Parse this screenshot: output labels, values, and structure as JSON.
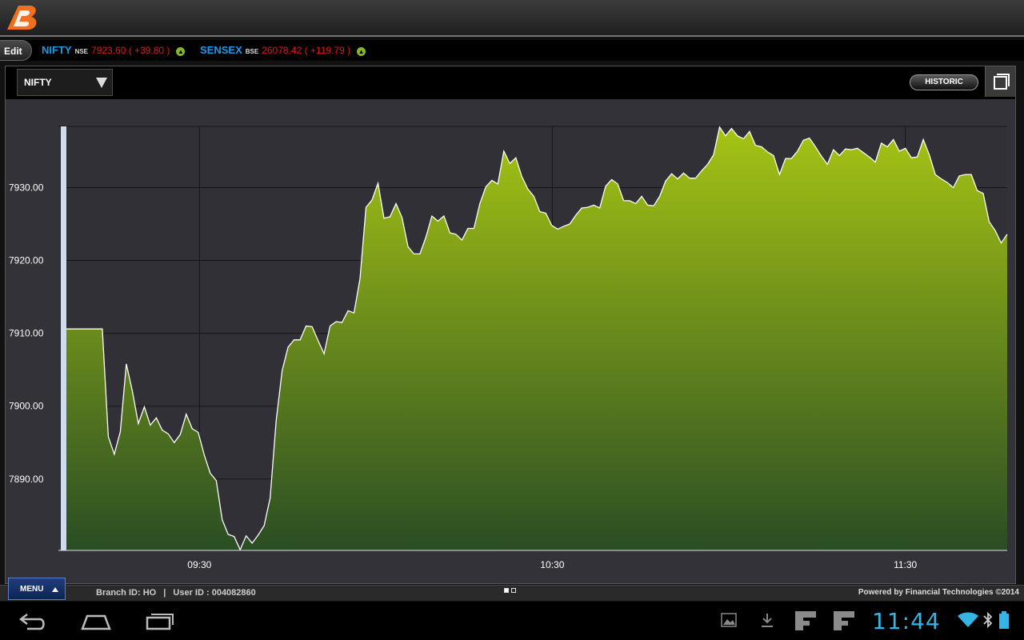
{
  "app": {
    "logo_icon": "bank-of-baroda-logo-icon",
    "accent": "#f07020"
  },
  "ticker": {
    "edit_label": "Edit",
    "items": [
      {
        "name": "NIFTY",
        "exchange": "NSE",
        "value": "7923.60 ( +39.80 )",
        "trend_icon": "up-arrow-icon"
      },
      {
        "name": "SENSEX",
        "exchange": "BSE",
        "value": "26078.42 ( +119.79 )",
        "trend_icon": "up-arrow-icon"
      }
    ]
  },
  "toolbar": {
    "index_selected": "NIFTY",
    "historic_label": "HISTORIC"
  },
  "chart_data": {
    "type": "area",
    "series": [
      {
        "values": [
          7910.6,
          7910.6,
          7910.6,
          7910.6,
          7910.6,
          7910.6,
          7910.6,
          7895.8,
          7893.4,
          7896.5,
          7905.8,
          7902.1,
          7897.6,
          7899.9,
          7897.4,
          7898.4,
          7896.7,
          7896.2,
          7895.0,
          7896.1,
          7898.9,
          7896.9,
          7896.4,
          7893.3,
          7890.8,
          7889.8,
          7884.4,
          7882.4,
          7882.1,
          7880.3,
          7882.2,
          7881.2,
          7882.3,
          7883.6,
          7887.4,
          7898.0,
          7904.9,
          7908.1,
          7909.1,
          7909.1,
          7911.0,
          7910.9,
          7909.0,
          7907.2,
          7911.0,
          7911.6,
          7911.5,
          7913.1,
          7912.8,
          7917.5,
          7927.3,
          7928.3,
          7930.6,
          7925.8,
          7926.0,
          7927.8,
          7925.9,
          7921.9,
          7920.9,
          7920.9,
          7923.2,
          7926.1,
          7925.4,
          7926.1,
          7923.8,
          7923.6,
          7922.8,
          7924.4,
          7924.4,
          7927.8,
          7930.1,
          7931.0,
          7930.5,
          7935.0,
          7933.3,
          7934.1,
          7931.5,
          7929.8,
          7928.8,
          7926.7,
          7926.5,
          7924.8,
          7924.3,
          7924.7,
          7925.0,
          7926.2,
          7927.2,
          7927.3,
          7927.6,
          7927.2,
          7930.2,
          7931.1,
          7930.5,
          7928.2,
          7928.2,
          7927.8,
          7928.8,
          7927.6,
          7927.5,
          7928.8,
          7930.9,
          7931.9,
          7931.2,
          7932.0,
          7931.3,
          7931.3,
          7932.3,
          7933.2,
          7934.5,
          7938.3,
          7937.1,
          7938.1,
          7937.1,
          7936.7,
          7937.7,
          7935.8,
          7935.6,
          7934.9,
          7934.4,
          7931.8,
          7934.0,
          7934.0,
          7935.0,
          7936.5,
          7936.8,
          7935.6,
          7934.3,
          7933.2,
          7935.2,
          7934.4,
          7935.3,
          7935.2,
          7935.4,
          7934.8,
          7934.2,
          7933.5,
          7936.1,
          7935.6,
          7936.6,
          7935.0,
          7935.4,
          7934.1,
          7934.2,
          7936.6,
          7934.5,
          7931.8,
          7931.2,
          7930.7,
          7930.0,
          7931.6,
          7931.8,
          7931.8,
          7929.6,
          7929.2,
          7925.3,
          7924.1,
          7922.4,
          7923.6
        ]
      }
    ],
    "x_tick_labels": [
      "09:30",
      "10:30",
      "11:30"
    ],
    "x_tick_fractions": [
      0.1414,
      0.5165,
      0.8917
    ],
    "y_ticks": [
      7930,
      7920,
      7910,
      7900,
      7890
    ],
    "y_tick_labels": [
      "7930.00",
      "7920.00",
      "7910.00",
      "7900.00",
      "7890.00"
    ],
    "ylim": [
      7880.2,
      7938.4
    ],
    "grid": true,
    "fill_top": "#a5c414",
    "fill_bottom": "#2a4d24",
    "line_color": "#ffffff"
  },
  "footer": {
    "menu_label": "MENU",
    "branch_label": "Branch ID:",
    "branch_value": "HO",
    "user_label": "User ID :",
    "user_value": "004082860",
    "powered_by": "Powered by Financial Technologies ©2014",
    "pages": 2,
    "active_page": 1
  },
  "system": {
    "clock": "11:44",
    "nav_icons": [
      "back-icon",
      "home-icon",
      "recent-apps-icon"
    ],
    "status_icons": [
      "gallery-icon",
      "download-icon",
      "app-f-icon",
      "app-f-icon",
      "wifi-icon",
      "bluetooth-icon",
      "battery-icon"
    ]
  }
}
